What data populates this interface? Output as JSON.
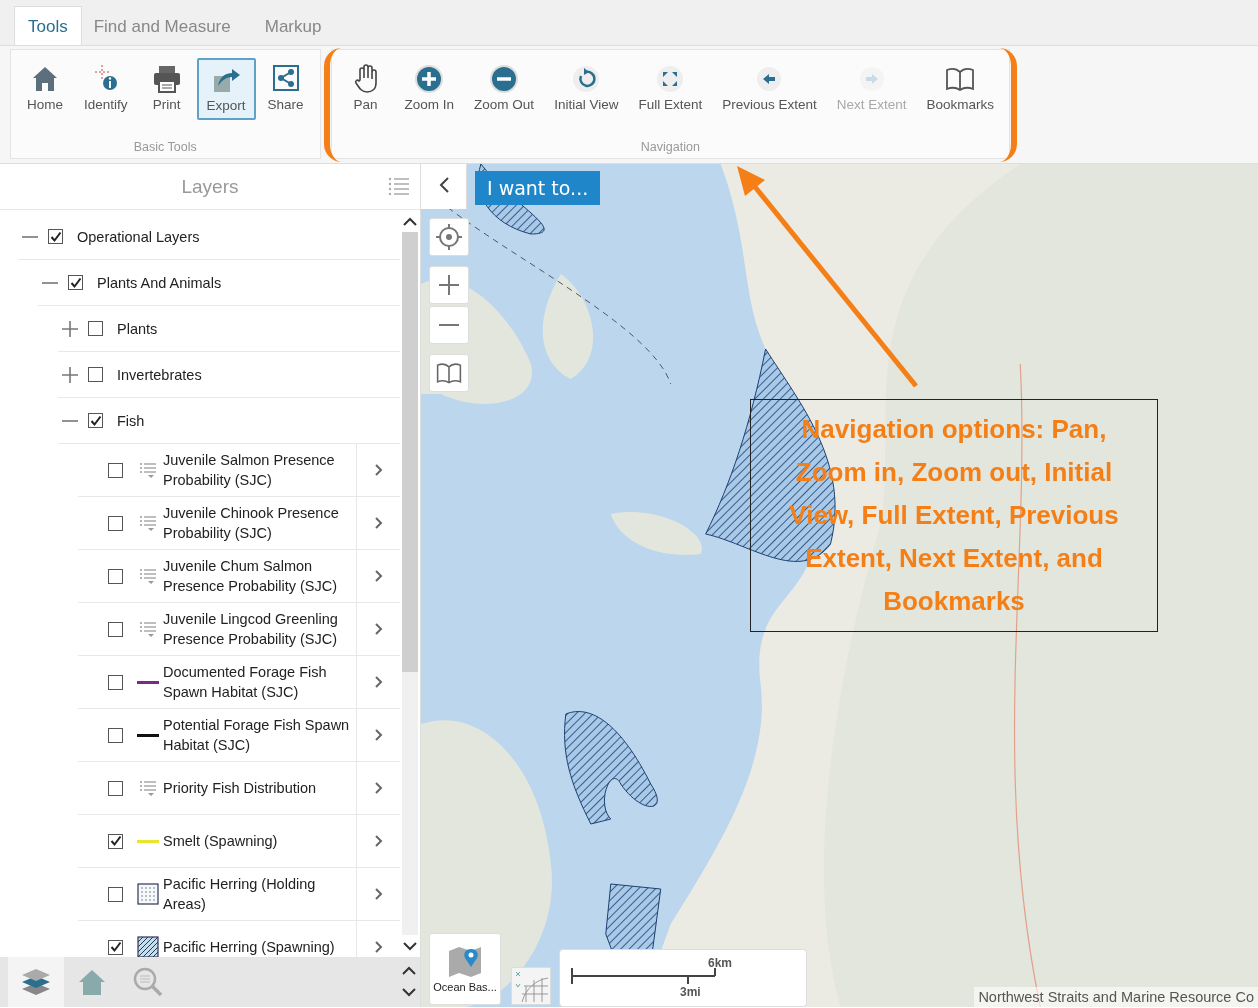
{
  "tabs": [
    {
      "label": "Tools",
      "selected": true
    },
    {
      "label": "Find and Measure",
      "selected": false
    },
    {
      "label": "Markup",
      "selected": false
    }
  ],
  "ribbon": [
    {
      "title": "Basic Tools",
      "highlighted": false,
      "tools": [
        {
          "label": "Home",
          "selected": false,
          "disabled": false
        },
        {
          "label": "Identify",
          "selected": false,
          "disabled": false
        },
        {
          "label": "Print",
          "selected": false,
          "disabled": false
        },
        {
          "label": "Export",
          "selected": true,
          "disabled": false
        },
        {
          "label": "Share",
          "selected": false,
          "disabled": false
        }
      ]
    },
    {
      "title": "Navigation",
      "highlighted": true,
      "tools": [
        {
          "label": "Pan",
          "selected": false,
          "disabled": false
        },
        {
          "label": "Zoom In",
          "selected": false,
          "disabled": false
        },
        {
          "label": "Zoom Out",
          "selected": false,
          "disabled": false
        },
        {
          "label": "Initial View",
          "selected": false,
          "disabled": false
        },
        {
          "label": "Full Extent",
          "selected": false,
          "disabled": false
        },
        {
          "label": "Previous Extent",
          "selected": false,
          "disabled": false
        },
        {
          "label": "Next Extent",
          "selected": false,
          "disabled": true
        },
        {
          "label": "Bookmarks",
          "selected": false,
          "disabled": false
        }
      ]
    }
  ],
  "layers_panel": {
    "title": "Layers",
    "tree": [
      {
        "label": "Operational Layers",
        "checked": true,
        "expanded": true,
        "children": [
          {
            "label": "Plants And Animals",
            "checked": true,
            "expanded": true,
            "children": [
              {
                "label": "Plants",
                "checked": false,
                "expanded": false
              },
              {
                "label": "Invertebrates",
                "checked": false,
                "expanded": false
              },
              {
                "label": "Fish",
                "checked": true,
                "expanded": true,
                "children": [
                  {
                    "label": "Juvenile Salmon Presence Probability (SJC)",
                    "checked": false,
                    "legend": {
                      "kind": "classes"
                    }
                  },
                  {
                    "label": "Juvenile Chinook Presence Probability (SJC)",
                    "checked": false,
                    "legend": {
                      "kind": "classes"
                    }
                  },
                  {
                    "label": "Juvenile Chum Salmon Presence Probability (SJC)",
                    "checked": false,
                    "legend": {
                      "kind": "classes"
                    }
                  },
                  {
                    "label": "Juvenile Lingcod Greenling Presence Probability (SJC)",
                    "checked": false,
                    "legend": {
                      "kind": "classes"
                    }
                  },
                  {
                    "label": "Documented Forage Fish Spawn Habitat (SJC)",
                    "checked": false,
                    "legend": {
                      "kind": "line",
                      "color": "#7b2a8a"
                    }
                  },
                  {
                    "label": "Potential Forage Fish Spawn Habitat (SJC)",
                    "checked": false,
                    "legend": {
                      "kind": "line",
                      "color": "#111111"
                    }
                  },
                  {
                    "label": "Priority Fish Distribution",
                    "checked": false,
                    "legend": {
                      "kind": "classes"
                    }
                  },
                  {
                    "label": "Smelt (Spawning)",
                    "checked": true,
                    "legend": {
                      "kind": "line",
                      "color": "#e6e62a"
                    }
                  },
                  {
                    "label": "Pacific Herring (Holding Areas)",
                    "checked": false,
                    "legend": {
                      "kind": "dotted"
                    }
                  },
                  {
                    "label": "Pacific Herring (Spawning)",
                    "checked": true,
                    "legend": {
                      "kind": "hatched"
                    }
                  }
                ]
              }
            ]
          }
        ]
      }
    ],
    "bottom_tabs": [
      {
        "selected": true
      },
      {
        "selected": false
      },
      {
        "selected": false
      }
    ]
  },
  "map": {
    "i_want_to": "I want to...",
    "basemap": "Ocean Bas...",
    "scale": {
      "km": "6km",
      "mi": "3mi"
    },
    "attribution": "Northwest Straits and Marine Resource Co"
  },
  "annotation": {
    "text": "Navigation options: Pan, Zoom in, Zoom out, Initial View, Full Extent, Previous Extent, Next Extent, and Bookmarks"
  }
}
